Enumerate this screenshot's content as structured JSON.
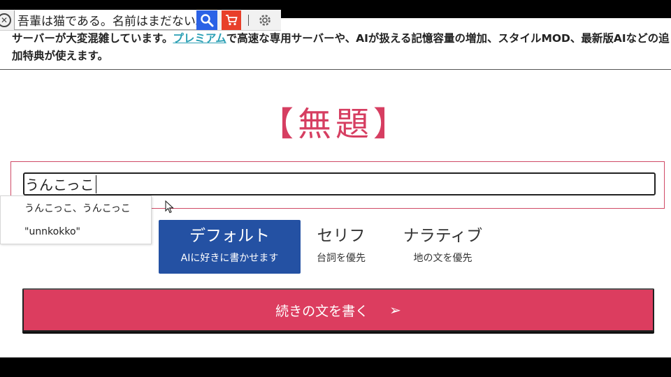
{
  "toolbar": {
    "query_value": "吾輩は猫である。名前はまだない。",
    "close_glyph": "✕"
  },
  "notice": {
    "text_before": "サーバーが大変混雑しています。",
    "link": "プレミアム",
    "text_after": "で高速な専用サーバーや、AIが扱える記憶容量の増加、スタイルMOD、最新版AIなどの追加特典が使えます。"
  },
  "title": "【無題】",
  "main_input": {
    "composing_text": "うんこっこ"
  },
  "ime_candidates": [
    "うんこっこ、うんこっこ",
    "\"unnkokko\""
  ],
  "modes": [
    {
      "title": "デフォルト",
      "subtitle": "AIに好きに書かせます",
      "active": true
    },
    {
      "title": "セリフ",
      "subtitle": "台詞を優先",
      "active": false
    },
    {
      "title": "ナラティブ",
      "subtitle": "地の文を優先",
      "active": false
    }
  ],
  "write_button": {
    "label": "続きの文を書く",
    "arrow": "➢"
  },
  "colors": {
    "accent": "#dc3d5f",
    "title": "#d63e61",
    "mode_active": "#2451a3",
    "link": "#2a9fb4"
  }
}
